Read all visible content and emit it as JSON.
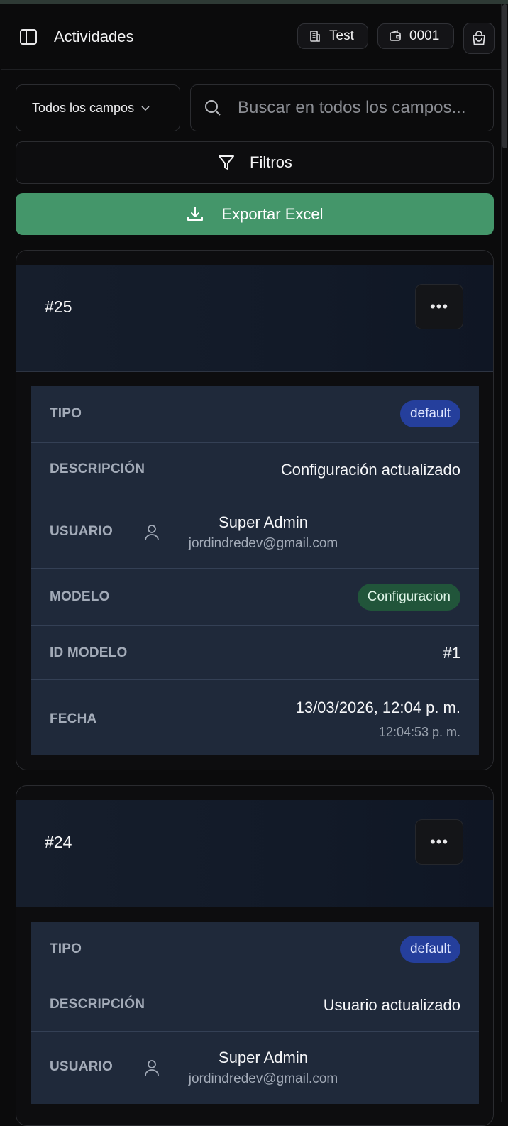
{
  "header": {
    "title": "Actividades",
    "company_label": "Test",
    "branch_label": "0001"
  },
  "toolbar": {
    "field_select_value": "Todos los campos",
    "search_placeholder": "Buscar en todos los campos...",
    "filters_label": "Filtros",
    "export_label": "Exportar Excel"
  },
  "colors": {
    "export_button": "#44966a",
    "badge_default": "#253f9c",
    "badge_model": "#21553a",
    "detail_panel": "#1f293a"
  },
  "field_labels": {
    "tipo": "TIPO",
    "descripcion": "DESCRIPCIÓN",
    "usuario": "USUARIO",
    "modelo": "MODELO",
    "id_modelo": "ID MODELO",
    "fecha": "FECHA"
  },
  "activities": [
    {
      "id": "#25",
      "tipo": "default",
      "descripcion": "Configuración actualizado",
      "usuario_nombre": "Super Admin",
      "usuario_email": "jordindredev@gmail.com",
      "modelo": "Configuracion",
      "id_modelo": "#1",
      "fecha": "13/03/2026, 12:04 p. m.",
      "hora": "12:04:53 p. m."
    },
    {
      "id": "#24",
      "tipo": "default",
      "descripcion": "Usuario actualizado",
      "usuario_nombre": "Super Admin",
      "usuario_email": "jordindredev@gmail.com"
    }
  ]
}
